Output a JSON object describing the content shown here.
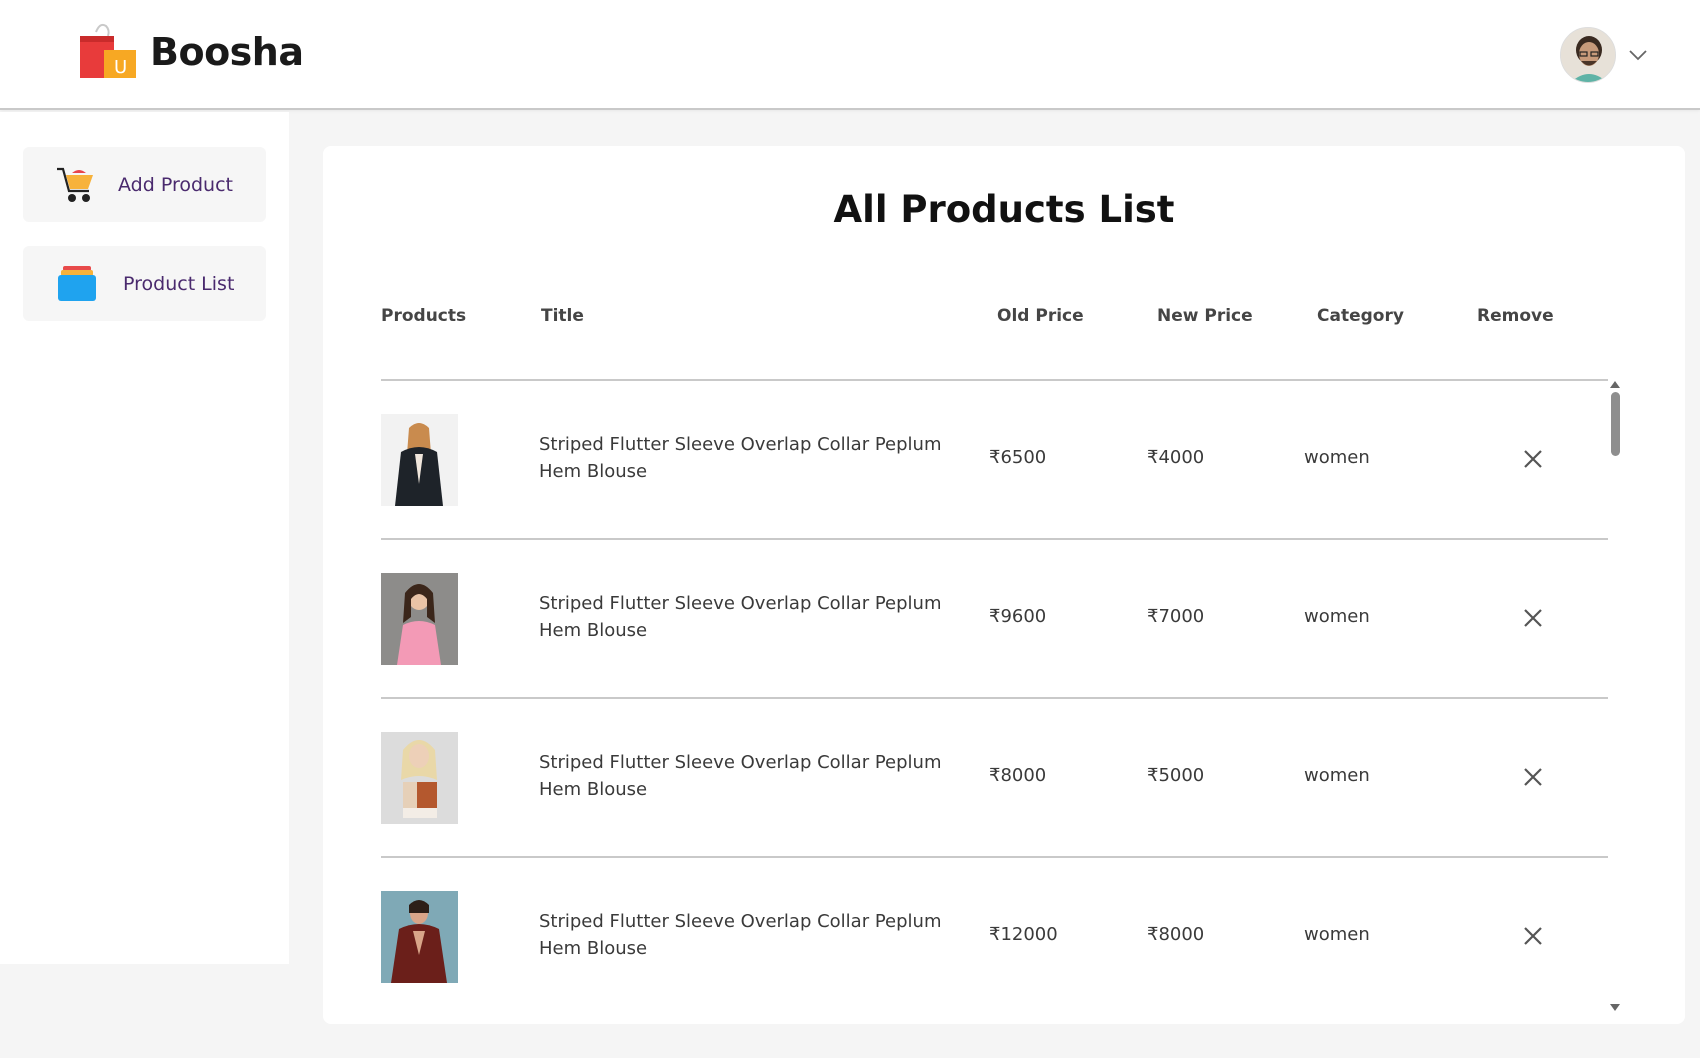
{
  "header": {
    "brand_name": "Boosha",
    "logo_letter": "U"
  },
  "sidebar": {
    "items": [
      {
        "label": "Add Product",
        "icon": "cart-icon"
      },
      {
        "label": "Product List",
        "icon": "product-list-icon"
      }
    ]
  },
  "main": {
    "title": "All Products List",
    "columns": [
      "Products",
      "Title",
      "Old Price",
      "New Price",
      "Category",
      "Remove"
    ],
    "rows": [
      {
        "title": "Striped Flutter Sleeve Overlap Collar Peplum Hem Blouse",
        "old_price": "₹6500",
        "new_price": "₹4000",
        "category": "women",
        "image": "product-photo"
      },
      {
        "title": "Striped Flutter Sleeve Overlap Collar Peplum Hem Blouse",
        "old_price": "₹9600",
        "new_price": "₹7000",
        "category": "women",
        "image": "product-photo"
      },
      {
        "title": "Striped Flutter Sleeve Overlap Collar Peplum Hem Blouse",
        "old_price": "₹8000",
        "new_price": "₹5000",
        "category": "women",
        "image": "product-photo"
      },
      {
        "title": "Striped Flutter Sleeve Overlap Collar Peplum Hem Blouse",
        "old_price": "₹12000",
        "new_price": "₹8000",
        "category": "women",
        "image": "product-photo"
      }
    ]
  },
  "colors": {
    "sidebar_label": "#4a2a6e",
    "panel_bg": "#ffffff",
    "page_bg": "#f5f5f5"
  }
}
